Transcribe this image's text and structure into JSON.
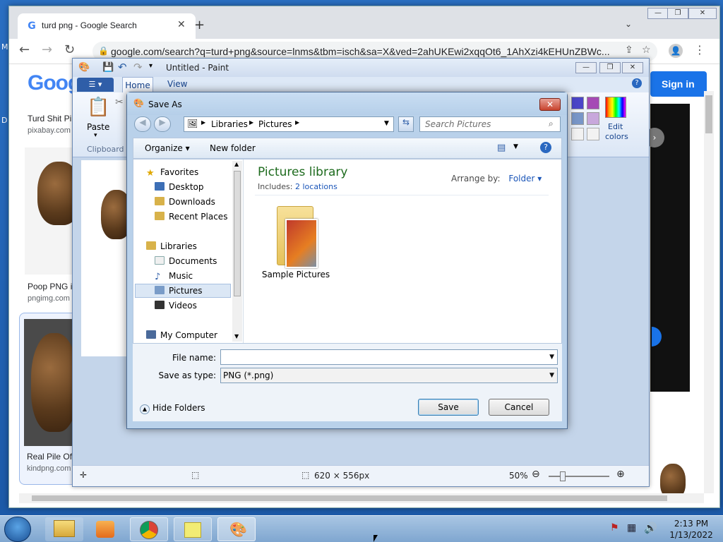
{
  "desktop": {
    "left_label": "M",
    "left_label2": "D"
  },
  "chrome": {
    "tab_title": "turd png - Google Search",
    "tab_close": "✕",
    "new_tab": "+",
    "url": "google.com/search?q=turd+png&source=lnms&tbm=isch&sa=X&ved=2ahUKEwi2xqqOt6_1AhXzi4kEHUnZBWc..."
  },
  "google": {
    "logo": "Goog",
    "sign_in": "Sign in",
    "results": [
      {
        "title": "Turd Shit Pi",
        "source": "pixabay.com"
      },
      {
        "title": "Poop PNG i",
        "source": "pngimg.com"
      },
      {
        "title": "Real Pile Of",
        "source": "kindpng.com"
      }
    ]
  },
  "paint": {
    "title": "Untitled - Paint",
    "tab_home": "Home",
    "tab_view": "View",
    "paste_label": "Paste",
    "clipboard_label": "Clipboard",
    "edit_colors_line1": "Edit",
    "edit_colors_line2": "colors",
    "canvas_size": "620 × 556px",
    "zoom": "50%"
  },
  "save_dialog": {
    "title": "Save As",
    "breadcrumb": [
      "Libraries",
      "Pictures"
    ],
    "search_placeholder": "Search Pictures",
    "organize": "Organize",
    "new_folder": "New folder",
    "nav": {
      "favorites": "Favorites",
      "desktop": "Desktop",
      "downloads": "Downloads",
      "recent_places": "Recent Places",
      "libraries": "Libraries",
      "documents": "Documents",
      "music": "Music",
      "pictures": "Pictures",
      "videos": "Videos",
      "my_computer": "My Computer"
    },
    "library_title": "Pictures library",
    "includes_label": "Includes:",
    "includes_link": "2 locations",
    "arrange_by_label": "Arrange by:",
    "arrange_by_value": "Folder",
    "folder_name": "Sample Pictures",
    "file_name_label": "File name:",
    "file_name_value": "",
    "save_type_label": "Save as type:",
    "save_type_value": "PNG (*.png)",
    "hide_folders": "Hide Folders",
    "save_button": "Save",
    "cancel_button": "Cancel"
  },
  "taskbar": {
    "time": "2:13 PM",
    "date": "1/13/2022"
  },
  "colors": {
    "google_blue": "#1a73e8",
    "paint_file_tab": "#2f5ea8",
    "dialog_close": "#c8442e",
    "library_title": "#1e6b1e"
  }
}
